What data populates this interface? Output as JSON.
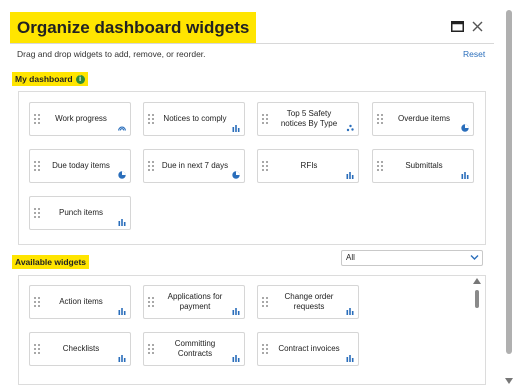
{
  "dialog": {
    "title": "Organize dashboard widgets",
    "subtitle": "Drag and drop widgets to add, remove, or reorder.",
    "reset_label": "Reset"
  },
  "my_dashboard": {
    "label": "My dashboard",
    "info_glyph": "i",
    "widgets": [
      {
        "label": "Work progress",
        "icon": "gauge-icon"
      },
      {
        "label": "Notices to comply",
        "icon": "bar-chart-icon"
      },
      {
        "label": "Top 5 Safety notices By Type",
        "icon": "scatter-icon"
      },
      {
        "label": "Overdue items",
        "icon": "pie-chart-icon"
      },
      {
        "label": "Due today items",
        "icon": "pie-chart-icon"
      },
      {
        "label": "Due in next 7 days",
        "icon": "pie-chart-icon"
      },
      {
        "label": "RFIs",
        "icon": "bar-chart-icon"
      },
      {
        "label": "Submittals",
        "icon": "bar-chart-icon"
      },
      {
        "label": "Punch items",
        "icon": "bar-chart-icon"
      }
    ]
  },
  "available": {
    "label": "Available widgets",
    "filter_value": "All",
    "widgets": [
      {
        "label": "Action items",
        "icon": "bar-chart-icon"
      },
      {
        "label": "Applications for payment",
        "icon": "bar-chart-icon"
      },
      {
        "label": "Change order requests",
        "icon": "bar-chart-icon"
      },
      {
        "label": "Checklists",
        "icon": "bar-chart-icon"
      },
      {
        "label": "Committing Contracts",
        "icon": "bar-chart-icon"
      },
      {
        "label": "Contract invoices",
        "icon": "bar-chart-icon"
      }
    ]
  },
  "colors": {
    "highlight": "#ffe500",
    "accent": "#2a6ebb",
    "info_badge": "#2e8b3a"
  }
}
